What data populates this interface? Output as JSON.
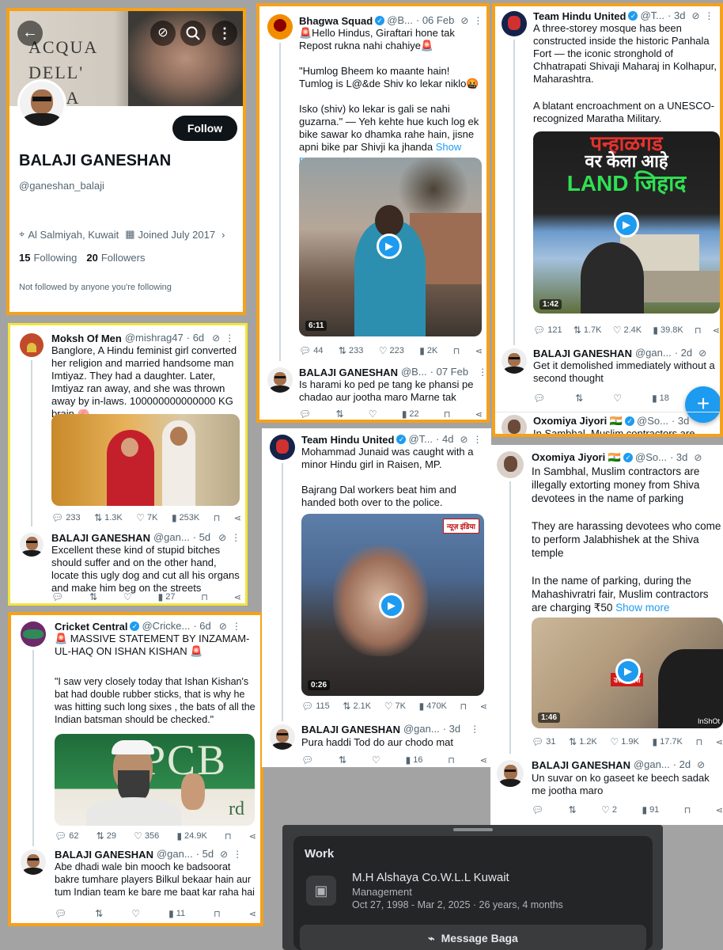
{
  "profile": {
    "name": "BALAJI GANESHAN",
    "handle": "@ganeshan_balaji",
    "location": "Al Salmiyah, Kuwait",
    "joined": "Joined July 2017",
    "following_count": "15",
    "following_label": "Following",
    "followers_count": "20",
    "followers_label": "Followers",
    "not_followed": "Not followed by anyone you're following",
    "follow_label": "Follow",
    "banner_text": "ACQUA DELL' ELBA"
  },
  "colors": {
    "panel_border": "#f5a11a",
    "yellow_border": "#f4e43c",
    "accent": "#1d9bf0"
  },
  "tweets": [
    {
      "author": "Moksh Of Men",
      "handle": "@mishrag47",
      "time": "· 6d",
      "text": "Banglore, A Hindu feminist girl converted her religion and married handsome man Imtiyaz. They had a daughter. Later, Imtiyaz ran away, and she was thrown away by in-laws. 100000000000000 KG brain 🧠",
      "replies": "233",
      "reposts": "1.3K",
      "likes": "7K",
      "views": "253K",
      "reply": {
        "author": "BALAJI GANESHAN",
        "handle": "@gan...",
        "time": "· 5d",
        "text": "Excellent these kind of stupid bitches should suffer and on the other hand, locate this ugly dog and cut all his organs and make him beg on the streets",
        "views": "27"
      }
    },
    {
      "author": "Cricket Central",
      "handle": "@Cricke...",
      "time": "· 6d",
      "text": "🚨 MASSIVE STATEMENT BY INZAMAM-UL-HAQ ON ISHAN KISHAN 🚨",
      "quote": "\"I saw very closely today that Ishan Kishan's bat had double rubber sticks, that is why he was hitting such long sixes , the bats of all the Indian batsman should be checked.\"",
      "image_text": "PCB",
      "image_text2": "rd",
      "replies": "62",
      "reposts": "29",
      "likes": "356",
      "views": "24.9K",
      "reply": {
        "author": "BALAJI GANESHAN",
        "handle": "@gan...",
        "time": "· 5d",
        "text": "Abe dhadi wale bin mooch ke badsoorat bakre tumhare players Bilkul bekaar hain aur tum Indian team ke bare me baat kar raha hai",
        "views": "11"
      }
    },
    {
      "author": "Bhagwa Squad",
      "handle": "@B...",
      "time": "· 06 Feb",
      "text1": "🚨Hello Hindus, Giraftari hone tak Repost rukna nahi chahiye🚨",
      "text2": "\"Humlog Bheem ko maante hain! Tumlog is L@&de Shiv ko lekar niklo🤬",
      "text3": "Isko (shiv) ko lekar is gali se nahi guzarna.\" — Yeh kehte hue kuch log ek bike sawar ko dhamka rahe hain, jisne apni bike par Shivji ka jhanda",
      "show_more": "Show more",
      "duration": "6:11",
      "replies": "44",
      "reposts": "233",
      "likes": "223",
      "views": "2K",
      "reply": {
        "author": "BALAJI GANESHAN",
        "handle": "@B...",
        "time": "· 07 Feb",
        "text": "Is harami ko ped pe tang ke phansi pe chadao aur jootha maro Marne tak",
        "views": "22"
      }
    },
    {
      "author": "Team Hindu United",
      "handle": "@T...",
      "time": "· 4d",
      "text1": "Mohammad Junaid was caught with a minor Hindu girl in Raisen, MP.",
      "text2": "Bajrang Dal workers beat him and handed both over to the police.",
      "badge": "न्यूज़ इंडिया",
      "duration": "0:26",
      "replies": "115",
      "reposts": "2.1K",
      "likes": "7K",
      "views": "470K",
      "reply": {
        "author": "BALAJI GANESHAN",
        "handle": "@gan...",
        "time": "· 3d",
        "text": "Pura haddi Tod do aur chodo mat",
        "views": "16"
      }
    },
    {
      "author": "Team Hindu United",
      "handle": "@T...",
      "time": "· 3d",
      "text1": "A three-storey mosque has been constructed inside the historic Panhala Fort — the iconic stronghold of Chhatrapati Shivaji Maharaj in Kolhapur, Maharashtra.",
      "text2": "A blatant encroachment on a UNESCO-recognized Maratha Military.",
      "image_line1": "पन्हाळगड",
      "image_line2": "वर केला आहे",
      "image_line3": "LAND जिहाद",
      "duration": "1:42",
      "replies": "121",
      "reposts": "1.7K",
      "likes": "2.4K",
      "views": "39.8K",
      "reply": {
        "author": "BALAJI GANESHAN",
        "handle": "@gan...",
        "time": "· 2d",
        "text": "Get it demolished immediately without a second thought",
        "views": "18"
      },
      "next_author": "Oxomiya Jiyori 🇮🇳",
      "next_handle": "@So...",
      "next_time": "· 3d",
      "next_text": "In Sambhal, Muslim contractors are"
    },
    {
      "author": "Oxomiya Jiyori 🇮🇳",
      "handle": "@So...",
      "time": "· 3d",
      "text1": "In Sambhal, Muslim contractors are illegally extorting money from Shiva devotees in the name of parking",
      "text2": "They are harassing devotees who come to perform Jalabhishek at the Shiva temple",
      "text3": "In the name of parking, during the Mahashivratri fair, Muslim contractors are charging ₹50",
      "show_more": "Show more",
      "badge": "उत्तर प्रदेश",
      "watermark": "InShOt",
      "duration": "1:46",
      "replies": "31",
      "reposts": "1.2K",
      "likes": "1.9K",
      "views": "17.7K",
      "reply": {
        "author": "BALAJI GANESHAN",
        "handle": "@gan...",
        "time": "· 2d",
        "text": "Un suvar on ko gaseet ke beech sadak me jootha maro",
        "likes": "2",
        "views": "91"
      }
    }
  ],
  "work": {
    "title": "Work",
    "company": "M.H Alshaya Co.W.L.L Kuwait",
    "role": "Management",
    "dates": "Oct 27, 1998 - Mar 2, 2025 · 26 years, 4 months",
    "message_label": "Message Baga"
  }
}
